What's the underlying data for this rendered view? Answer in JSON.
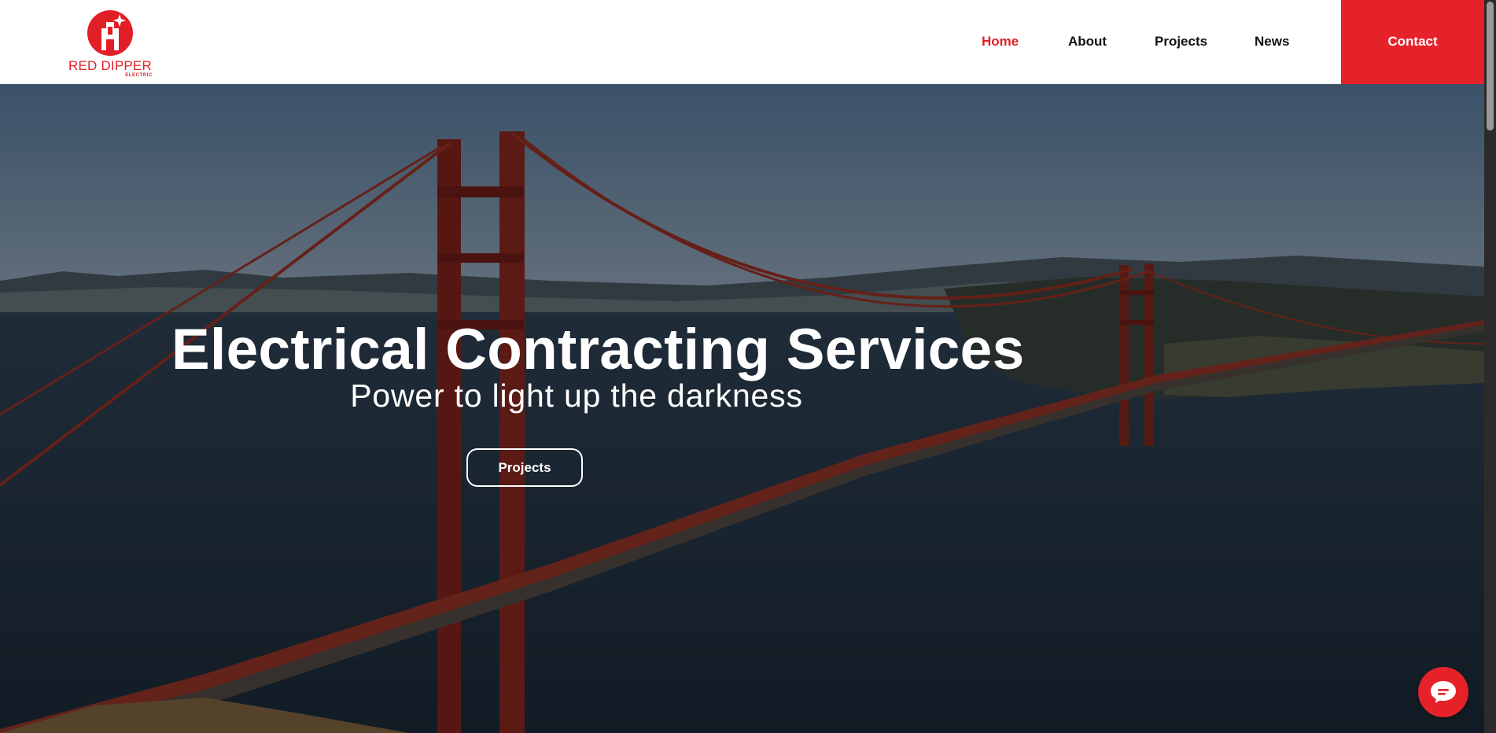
{
  "header": {
    "logo": {
      "name": "RED DIPPER",
      "sub": "ELECTRIC"
    },
    "nav": [
      {
        "label": "Home",
        "active": true
      },
      {
        "label": "About",
        "active": false
      },
      {
        "label": "Projects",
        "active": false
      },
      {
        "label": "News",
        "active": false
      }
    ],
    "contact_label": "Contact"
  },
  "hero": {
    "title": "Electrical Contracting Services",
    "subtitle": "Power to light up the darkness",
    "button_label": "Projects"
  },
  "chat": {
    "icon": "chat-bubble-icon"
  },
  "colors": {
    "brand_red": "#e5222a",
    "active_nav": "#e21f26",
    "nav_text": "#111111"
  }
}
